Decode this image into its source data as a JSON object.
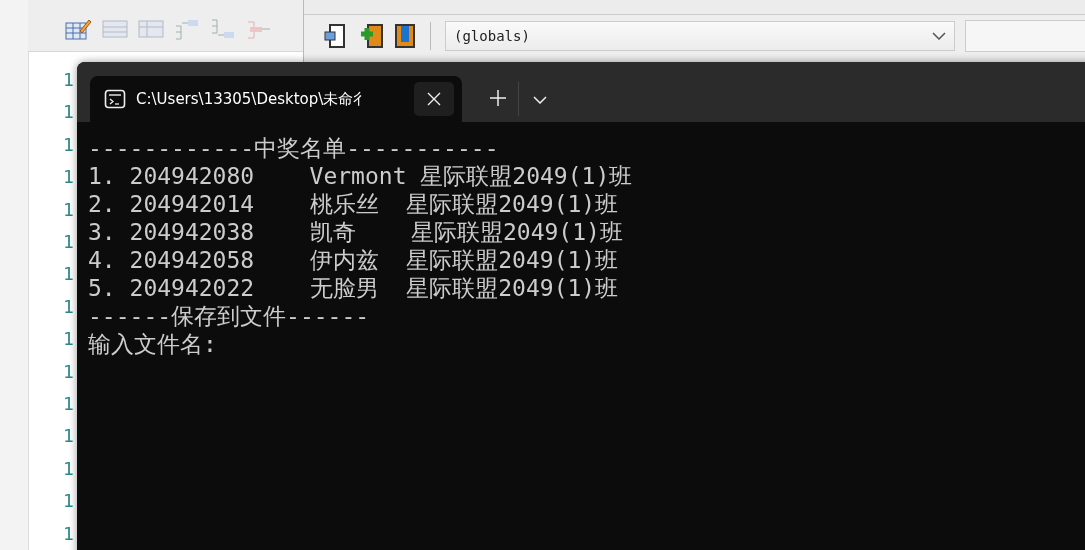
{
  "ide": {
    "line_numbers": [
      "1",
      "1",
      "1",
      "1",
      "1",
      "1",
      "1",
      "1",
      "1",
      "1",
      "1",
      "1",
      "1",
      "1",
      "1"
    ]
  },
  "editor_window": {
    "scope_dropdown": {
      "value": "(globals)"
    }
  },
  "terminal": {
    "tabs": [
      {
        "title": "C:\\Users\\13305\\Desktop\\未命彳",
        "selected": true
      }
    ],
    "lines": [
      "------------中奖名单-----------",
      "1. 204942080    Vermont 星际联盟2049(1)班",
      "2. 204942014    桃乐丝  星际联盟2049(1)班",
      "3. 204942038    凯奇    星际联盟2049(1)班",
      "4. 204942058    伊内兹  星际联盟2049(1)班",
      "5. 204942022    无脸男  星际联盟2049(1)班",
      "------保存到文件------",
      "输入文件名:"
    ]
  }
}
